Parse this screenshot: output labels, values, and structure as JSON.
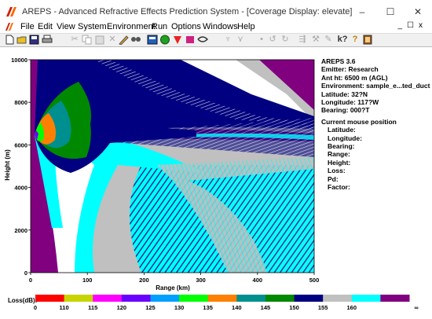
{
  "window": {
    "title": "AREPS - Advanced Refractive Effects Prediction System - [Coverage Display: elevate]",
    "minimize": "–",
    "maximize": "☐",
    "close": "✕"
  },
  "menu": {
    "items": [
      "File",
      "Edit",
      "View",
      "System",
      "Environment",
      "Run",
      "Options",
      "Windows",
      "Help"
    ],
    "mdi": [
      "_",
      "☐",
      "x"
    ]
  },
  "toolbar": {
    "icons": [
      "new-icon",
      "open-icon",
      "save-icon",
      "print-icon",
      "cut-icon",
      "copy-icon",
      "paste-icon",
      "delete-icon",
      "edit-icon",
      "find-icon",
      "calc-icon",
      "globe-icon",
      "run-icon",
      "signal-icon",
      "propagation-icon",
      "terrain-icon",
      "antenna-icon",
      "point-icon",
      "undo-icon",
      "redo-icon",
      "chart-icon",
      "tools-icon",
      "settings-icon",
      "help-icon",
      "hint-icon",
      "book-icon"
    ]
  },
  "info_panel": {
    "version": "AREPS 3.6",
    "emitter": "Emitter: Research",
    "ant_ht": "Ant ht: 6500 m (AGL)",
    "environment": "Environment: sample_e...ted_duct",
    "latitude": "Latitude:  32?N",
    "longitude": "Longitude: 117?W",
    "bearing": "Bearing: 000?T",
    "mouse_header": "Current mouse position",
    "mouse_fields": [
      "Latitude:",
      "Longitude:",
      "Bearing:",
      "Range:",
      "Height:",
      "Loss:",
      "Pd:",
      "Factor:"
    ]
  },
  "chart_data": {
    "type": "heatmap",
    "xlabel": "Range (km)",
    "ylabel": "Height (m)",
    "xlim": [
      0,
      500
    ],
    "ylim": [
      0,
      10000
    ],
    "xticks": [
      0,
      100,
      200,
      300,
      400,
      500
    ],
    "yticks": [
      0,
      2000,
      4000,
      6000,
      8000,
      10000
    ],
    "legend_label": "Loss(dB):",
    "legend_ticks": [
      "0",
      "110",
      "115",
      "120",
      "125",
      "130",
      "135",
      "140",
      "145",
      "150",
      "155",
      "160",
      "∞"
    ],
    "legend_colors": [
      "#ff0000",
      "#c8d400",
      "#ff00ff",
      "#6a00ff",
      "#00a0ff",
      "#00ff00",
      "#ff8000",
      "#008f8f",
      "#008800",
      "#000080",
      "#c0c0c0",
      "#00ffff",
      "#800080"
    ]
  }
}
